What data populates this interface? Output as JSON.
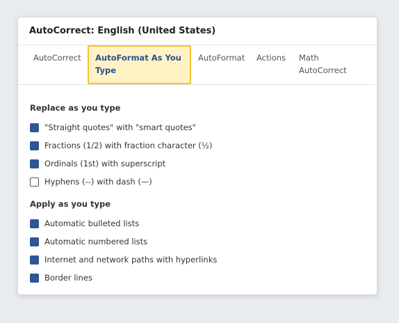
{
  "dialog": {
    "title": "AutoCorrect: English (United States)"
  },
  "tabs": [
    {
      "label": "AutoCorrect",
      "active": false
    },
    {
      "label_line1": "AutoFormat As You",
      "label_line2": "Type",
      "active": true
    },
    {
      "label": "AutoFormat",
      "active": false
    },
    {
      "label": "Actions",
      "active": false
    },
    {
      "label_line1": "Math",
      "label_line2": "AutoCorrect",
      "active": false
    }
  ],
  "replace_section": {
    "heading": "Replace as you type",
    "options": [
      {
        "label": "\"Straight quotes\" with \"smart quotes\"",
        "checked": true
      },
      {
        "label": "Fractions (1/2) with fraction character (½)",
        "checked": true
      },
      {
        "label": "Ordinals (1st) with superscript",
        "checked": true
      },
      {
        "label": "Hyphens (--) with dash (—)",
        "checked": false
      }
    ]
  },
  "apply_section": {
    "heading": "Apply as you type",
    "options": [
      {
        "label": "Automatic bulleted lists",
        "checked": true
      },
      {
        "label": "Automatic numbered lists",
        "checked": true
      },
      {
        "label": "Internet and network paths with hyperlinks",
        "checked": true
      },
      {
        "label": "Border lines",
        "checked": true
      }
    ]
  },
  "colors": {
    "accent": "#2f5597",
    "active_tab_bg": "#fff3c6",
    "active_tab_border": "#f4c233"
  }
}
